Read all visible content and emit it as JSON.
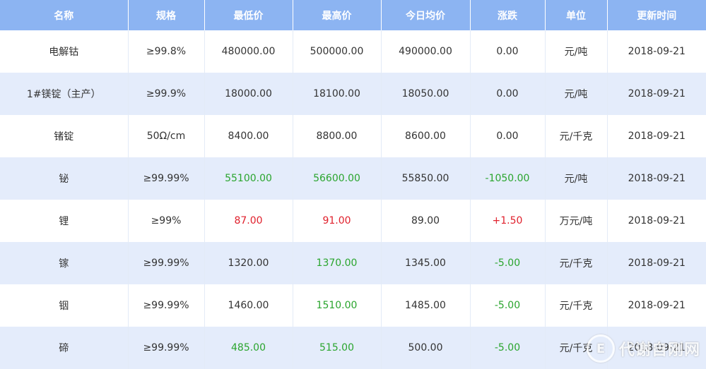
{
  "headers": {
    "name": "名称",
    "spec": "规格",
    "low": "最低价",
    "high": "最高价",
    "avg": "今日均价",
    "change": "涨跌",
    "unit": "单位",
    "updated": "更新时间"
  },
  "colors": {
    "header_bg": "#8cb4f2",
    "row_alt_bg": "#e4ecfb",
    "up": "#e0202c",
    "down": "#2aa52e"
  },
  "rows": [
    {
      "name": "电解钴",
      "spec": "≥99.8%",
      "low": "480000.00",
      "low_trend": "flat",
      "high": "500000.00",
      "high_trend": "flat",
      "avg": "490000.00",
      "change": "0.00",
      "change_trend": "flat",
      "unit": "元/吨",
      "updated": "2018-09-21"
    },
    {
      "name": "1#镁锭（主产）",
      "spec": "≥99.9%",
      "low": "18000.00",
      "low_trend": "flat",
      "high": "18100.00",
      "high_trend": "flat",
      "avg": "18050.00",
      "change": "0.00",
      "change_trend": "flat",
      "unit": "元/吨",
      "updated": "2018-09-21"
    },
    {
      "name": "锗锭",
      "spec": "50Ω/cm",
      "low": "8400.00",
      "low_trend": "flat",
      "high": "8800.00",
      "high_trend": "flat",
      "avg": "8600.00",
      "change": "0.00",
      "change_trend": "flat",
      "unit": "元/千克",
      "updated": "2018-09-21"
    },
    {
      "name": "铋",
      "spec": "≥99.99%",
      "low": "55100.00",
      "low_trend": "down",
      "high": "56600.00",
      "high_trend": "down",
      "avg": "55850.00",
      "change": "-1050.00",
      "change_trend": "down",
      "unit": "元/吨",
      "updated": "2018-09-21"
    },
    {
      "name": "锂",
      "spec": "≥99%",
      "low": "87.00",
      "low_trend": "up",
      "high": "91.00",
      "high_trend": "up",
      "avg": "89.00",
      "change": "+1.50",
      "change_trend": "up",
      "unit": "万元/吨",
      "updated": "2018-09-21"
    },
    {
      "name": "镓",
      "spec": "≥99.99%",
      "low": "1320.00",
      "low_trend": "flat",
      "high": "1370.00",
      "high_trend": "down",
      "avg": "1345.00",
      "change": "-5.00",
      "change_trend": "down",
      "unit": "元/千克",
      "updated": "2018-09-21"
    },
    {
      "name": "铟",
      "spec": "≥99.99%",
      "low": "1460.00",
      "low_trend": "flat",
      "high": "1510.00",
      "high_trend": "down",
      "avg": "1485.00",
      "change": "-5.00",
      "change_trend": "down",
      "unit": "元/千克",
      "updated": "2018-09-21"
    },
    {
      "name": "碲",
      "spec": "≥99.99%",
      "low": "485.00",
      "low_trend": "down",
      "high": "515.00",
      "high_trend": "down",
      "avg": "500.00",
      "change": "-5.00",
      "change_trend": "down",
      "unit": "元/千克",
      "updated": "2018-09-21"
    }
  ],
  "watermark": {
    "icon": "logo-icon",
    "text": "代谢自刚网"
  }
}
